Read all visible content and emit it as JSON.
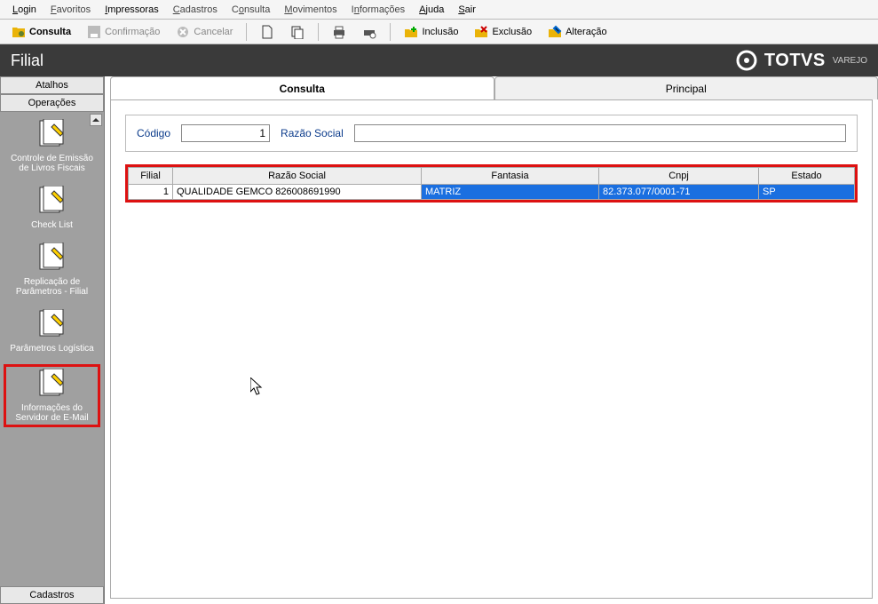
{
  "menu": {
    "login": "Login",
    "favoritos": "Favoritos",
    "impressoras": "Impressoras",
    "cadastros": "Cadastros",
    "consulta": "Consulta",
    "movimentos": "Movimentos",
    "informacoes": "Informações",
    "ajuda": "Ajuda",
    "sair": "Sair"
  },
  "toolbar": {
    "consulta": "Consulta",
    "confirmacao": "Confirmação",
    "cancelar": "Cancelar",
    "inclusao": "Inclusão",
    "exclusao": "Exclusão",
    "alteracao": "Alteração"
  },
  "title": "Filial",
  "brand": {
    "name": "TOTVS",
    "sub": "VAREJO"
  },
  "sidebar": {
    "atalhos": "Atalhos",
    "operacoes": "Operações",
    "cadastros": "Cadastros",
    "items": [
      {
        "label": "Controle de Emissão de Livros Fiscais"
      },
      {
        "label": "Check List"
      },
      {
        "label": "Replicação de Parâmetros - Filial"
      },
      {
        "label": "Parâmetros Logística"
      },
      {
        "label": "Informações do Servidor de E-Mail"
      }
    ]
  },
  "tabs": {
    "consulta": "Consulta",
    "principal": "Principal"
  },
  "filter": {
    "codigo_label": "Código",
    "codigo_value": "1",
    "razao_label": "Razão Social",
    "razao_value": ""
  },
  "grid": {
    "headers": {
      "filial": "Filial",
      "razao": "Razão Social",
      "fantasia": "Fantasia",
      "cnpj": "Cnpj",
      "estado": "Estado"
    },
    "rows": [
      {
        "filial": "1",
        "razao": "QUALIDADE GEMCO 826008691990",
        "fantasia": "MATRIZ",
        "cnpj": "82.373.077/0001-71",
        "estado": "SP"
      }
    ]
  }
}
